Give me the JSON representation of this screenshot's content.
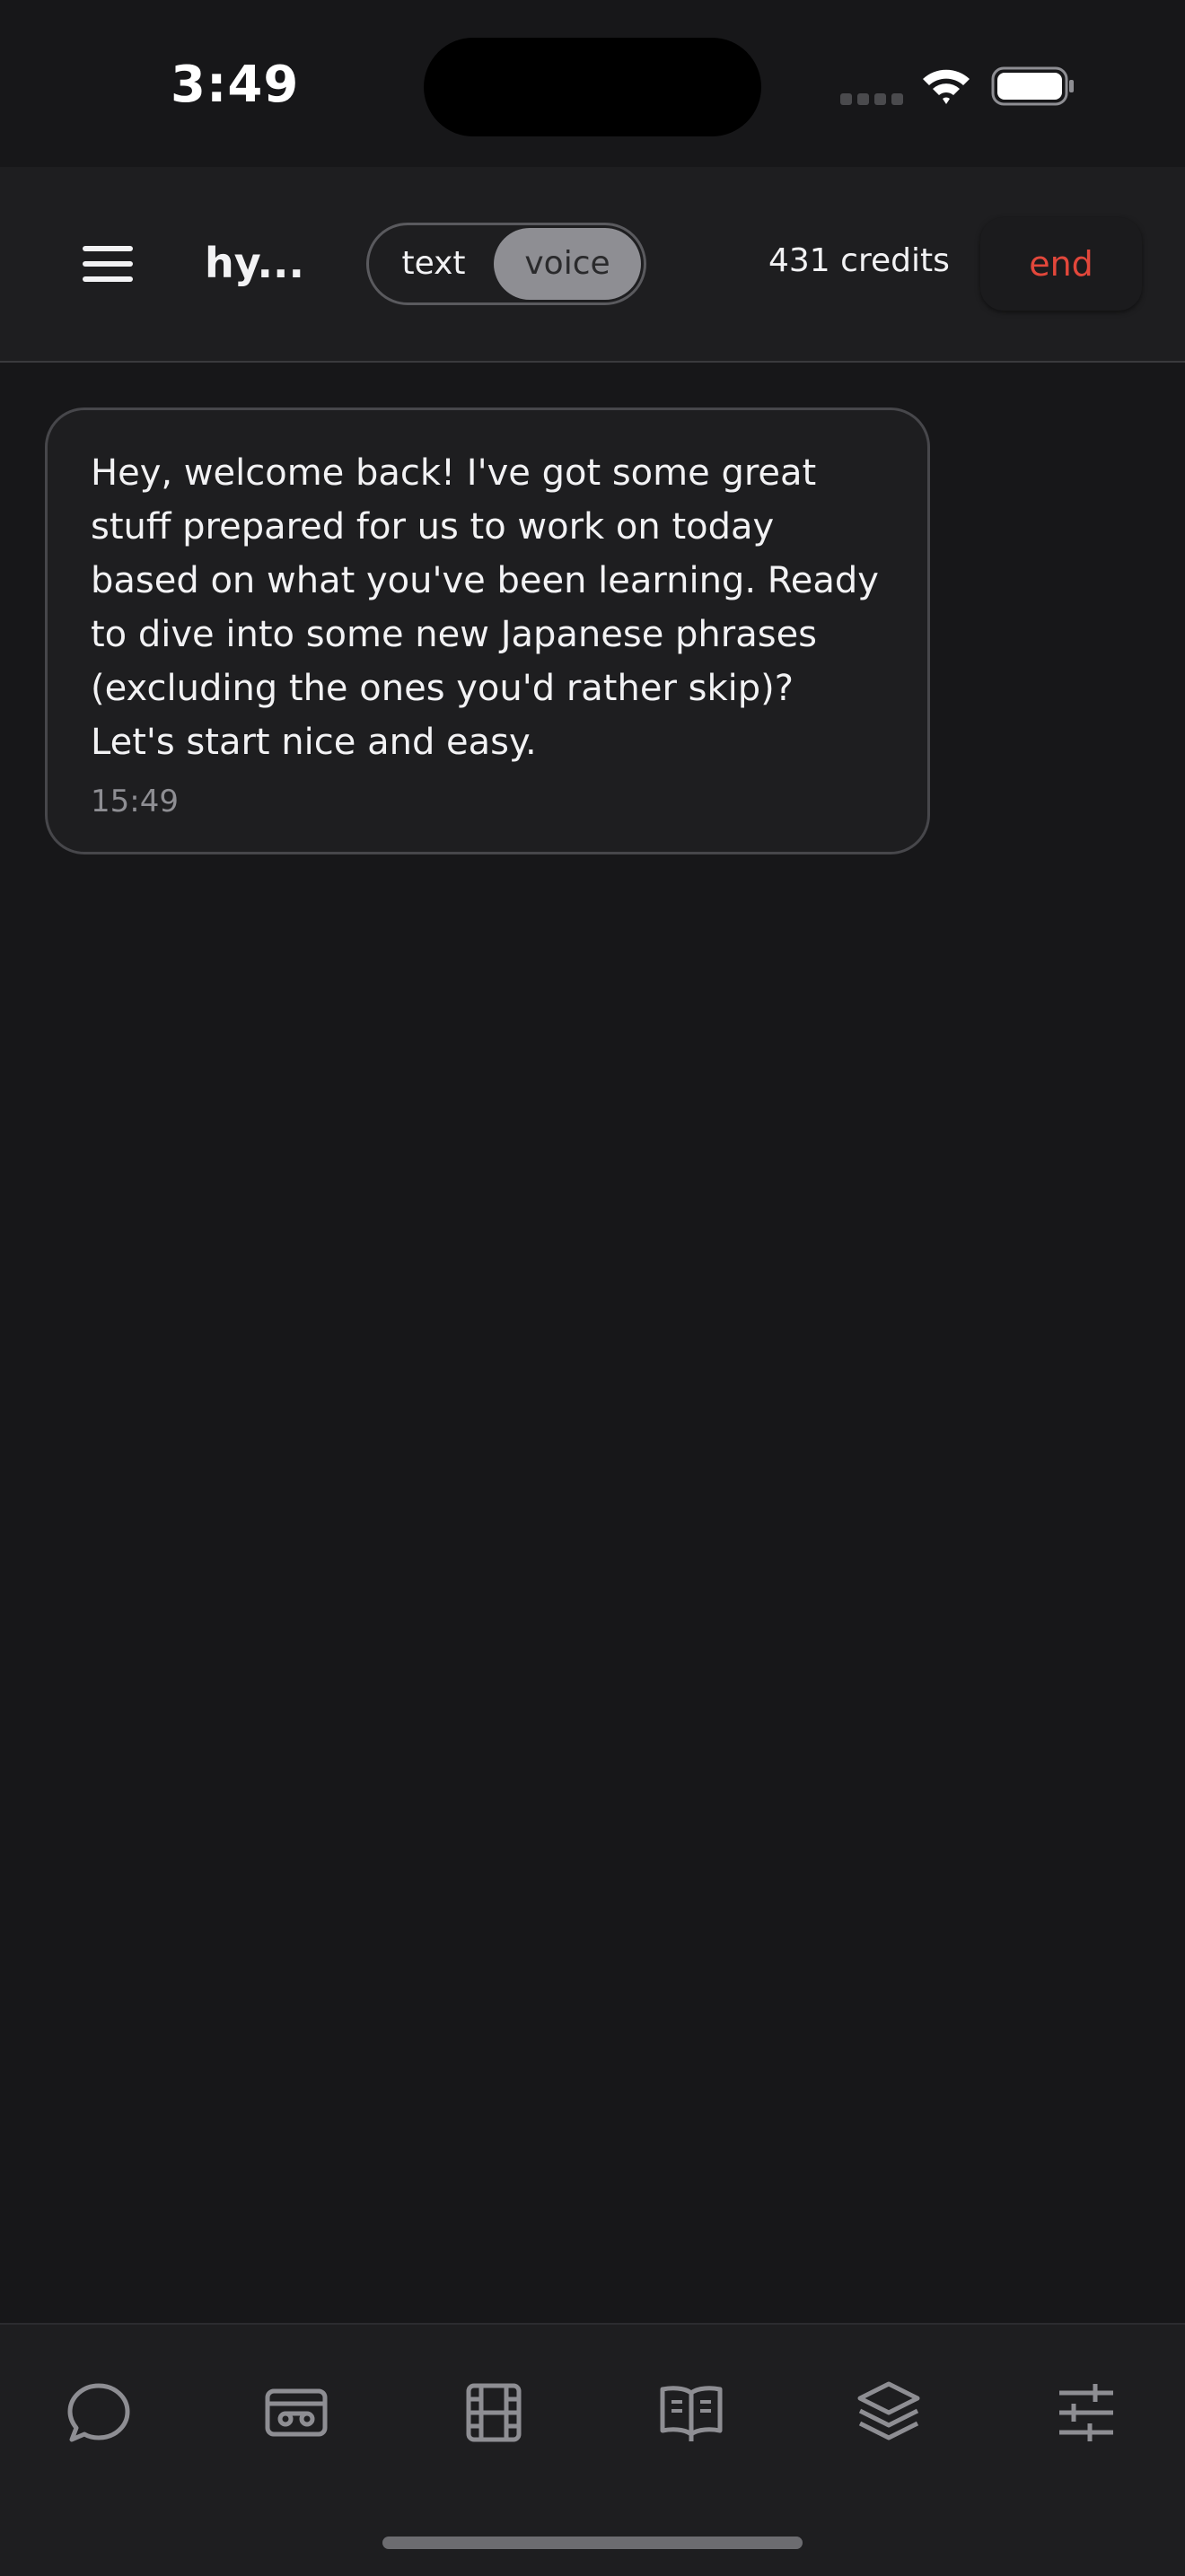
{
  "status_bar": {
    "time": "3:49"
  },
  "header": {
    "title": "hy...",
    "mode_text": "text",
    "mode_voice": "voice",
    "selected_mode": "voice",
    "credits": "431 credits",
    "end_label": "end"
  },
  "messages": [
    {
      "text": "Hey, welcome back! I've got some great stuff prepared for us to work on today based on what you've been learning. Ready to dive into some new Japanese phrases (excluding the ones you'd rather skip)? Let's start nice and easy.",
      "time": "15:49"
    }
  ],
  "tabbar": {
    "icons": [
      "chat-bubble-icon",
      "cassette-icon",
      "film-icon",
      "book-open-icon",
      "layers-icon",
      "sliders-icon"
    ]
  },
  "colors": {
    "background": "#171719",
    "surface": "#1e1e20",
    "accent_danger": "#e2473b",
    "toggle_active": "#8e8e93"
  }
}
